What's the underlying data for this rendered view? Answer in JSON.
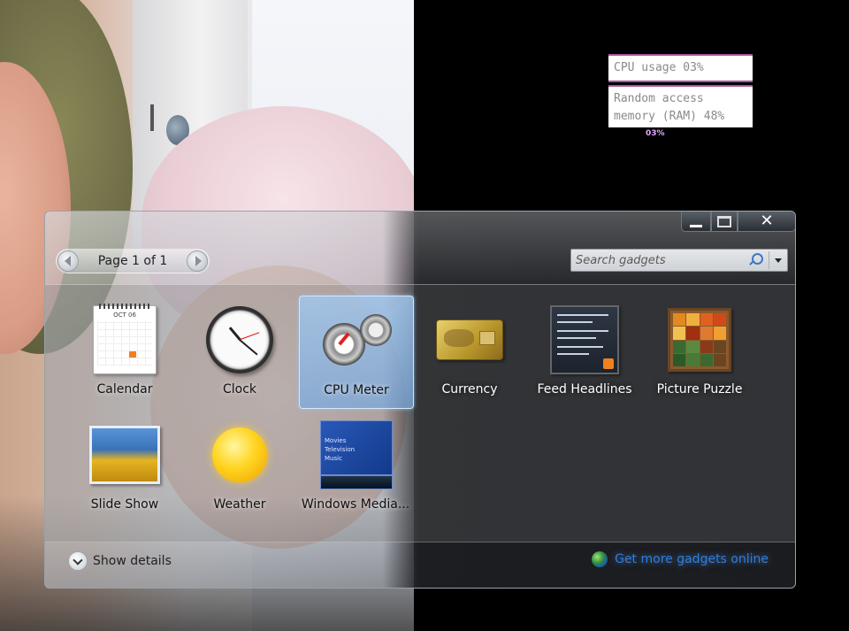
{
  "desktop": {
    "cpu_gadget": {
      "cpu_text": "CPU usage 03%",
      "ram_text_line1": "Random access",
      "ram_text_line2": "memory (RAM) 48%",
      "mini_text": "03%"
    }
  },
  "window": {
    "controls": {
      "minimize": "minimize-icon",
      "maximize": "maximize-icon",
      "close": "close-icon"
    },
    "pager": {
      "label": "Page 1 of 1"
    },
    "search": {
      "placeholder": "Search gadgets"
    },
    "gadgets": [
      {
        "label": "Calendar",
        "icon": "calendar-icon",
        "calendar_month": "OCT 06"
      },
      {
        "label": "Clock",
        "icon": "clock-icon"
      },
      {
        "label": "CPU Meter",
        "icon": "cpu-meter-icon",
        "selected": true
      },
      {
        "label": "Currency",
        "icon": "currency-icon"
      },
      {
        "label": "Feed Headlines",
        "icon": "feed-headlines-icon"
      },
      {
        "label": "Picture Puzzle",
        "icon": "picture-puzzle-icon"
      },
      {
        "label": "Slide Show",
        "icon": "slide-show-icon"
      },
      {
        "label": "Weather",
        "icon": "weather-icon"
      },
      {
        "label": "Windows Media...",
        "icon": "windows-media-center-icon",
        "menu": [
          "Movies",
          "Television",
          "Music"
        ]
      }
    ],
    "footer": {
      "details_label": "Show details",
      "online_label": "Get more gadgets online"
    }
  }
}
